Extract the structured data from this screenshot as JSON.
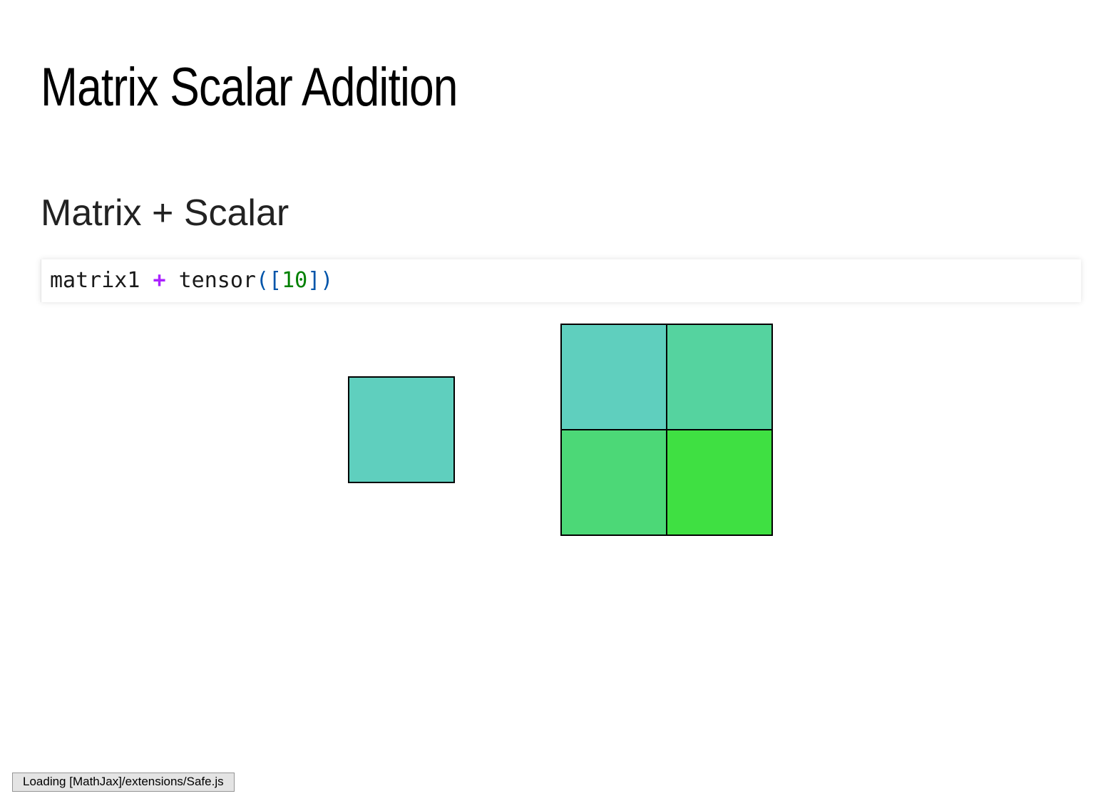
{
  "page": {
    "title": "Matrix Scalar Addition",
    "section_title": "Matrix + Scalar"
  },
  "code_cell": {
    "tokens": {
      "var": "matrix1",
      "op": "+",
      "func": "tensor",
      "open": "([",
      "num": "10",
      "close": "])"
    }
  },
  "output": {
    "scalar_tensor": {
      "shape": [
        1,
        1
      ],
      "cell_colors": [
        "#5fcfbe"
      ]
    },
    "result_matrix": {
      "shape": [
        2,
        2
      ],
      "cell_colors": [
        "#5fcfbe",
        "#55d39f",
        "#4cd877",
        "#3fe042"
      ]
    },
    "cell_border_color": "#000000"
  },
  "status_bar": {
    "text": "Loading [MathJax]/extensions/Safe.js"
  }
}
